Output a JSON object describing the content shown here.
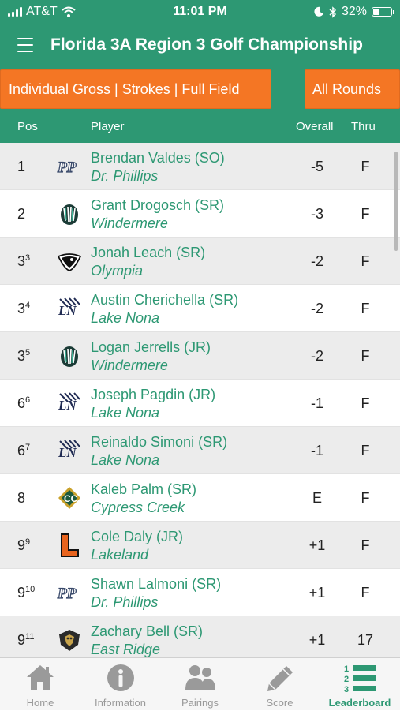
{
  "status": {
    "carrier": "AT&T",
    "time": "11:01 PM",
    "battery": "32%"
  },
  "header": {
    "title": "Florida 3A Region 3 Golf Championship"
  },
  "filters": {
    "left": "Individual Gross | Strokes | Full Field",
    "right": "All Rounds"
  },
  "columns": {
    "pos": "Pos",
    "player": "Player",
    "overall": "Overall",
    "thru": "Thru"
  },
  "rows": [
    {
      "pos": "1",
      "sup": "",
      "name": "Brendan Valdes (SO)",
      "team": "Dr. Phillips",
      "overall": "-5",
      "thru": "F",
      "logo": "dr-phillips-logo"
    },
    {
      "pos": "2",
      "sup": "",
      "name": "Grant Drogosch (SR)",
      "team": "Windermere",
      "overall": "-3",
      "thru": "F",
      "logo": "windermere-logo"
    },
    {
      "pos": "3",
      "sup": "3",
      "name": "Jonah Leach (SR)",
      "team": "Olympia",
      "overall": "-2",
      "thru": "F",
      "logo": "olympia-logo"
    },
    {
      "pos": "3",
      "sup": "4",
      "name": "Austin Cherichella (SR)",
      "team": "Lake Nona",
      "overall": "-2",
      "thru": "F",
      "logo": "lake-nona-logo"
    },
    {
      "pos": "3",
      "sup": "5",
      "name": "Logan Jerrells (JR)",
      "team": "Windermere",
      "overall": "-2",
      "thru": "F",
      "logo": "windermere-logo"
    },
    {
      "pos": "6",
      "sup": "6",
      "name": "Joseph  Pagdin (JR)",
      "team": "Lake Nona",
      "overall": "-1",
      "thru": "F",
      "logo": "lake-nona-logo"
    },
    {
      "pos": "6",
      "sup": "7",
      "name": "Reinaldo Simoni (SR)",
      "team": "Lake Nona",
      "overall": "-1",
      "thru": "F",
      "logo": "lake-nona-logo"
    },
    {
      "pos": "8",
      "sup": "",
      "name": "Kaleb Palm (SR)",
      "team": "Cypress Creek",
      "overall": "E",
      "thru": "F",
      "logo": "cypress-creek-logo"
    },
    {
      "pos": "9",
      "sup": "9",
      "name": "Cole Daly (JR)",
      "team": "Lakeland",
      "overall": "+1",
      "thru": "F",
      "logo": "lakeland-logo"
    },
    {
      "pos": "9",
      "sup": "10",
      "name": "Shawn Lalmoni (SR)",
      "team": "Dr. Phillips",
      "overall": "+1",
      "thru": "F",
      "logo": "dr-phillips-logo"
    },
    {
      "pos": "9",
      "sup": "11",
      "name": "Zachary Bell (SR)",
      "team": "East Ridge",
      "overall": "+1",
      "thru": "17",
      "logo": "east-ridge-logo"
    }
  ],
  "tabs": [
    {
      "label": "Home",
      "icon": "home-icon",
      "active": false
    },
    {
      "label": "Information",
      "icon": "info-icon",
      "active": false
    },
    {
      "label": "Pairings",
      "icon": "people-icon",
      "active": false
    },
    {
      "label": "Score",
      "icon": "pencil-icon",
      "active": false
    },
    {
      "label": "Leaderboard",
      "icon": "leaderboard-icon",
      "active": true
    }
  ],
  "colors": {
    "primary": "#2d9873",
    "accent": "#f47624",
    "row_alt": "#ececec",
    "tab_inactive": "#9a9a9a"
  }
}
